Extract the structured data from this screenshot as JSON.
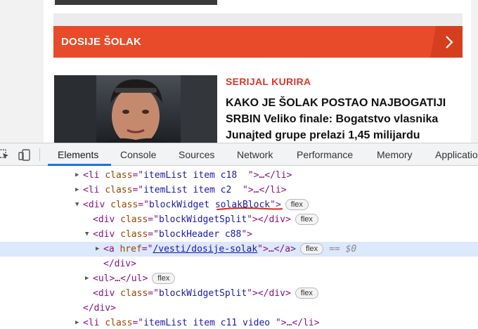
{
  "page": {
    "section_title": "DOSIJE ŠOLAK",
    "section_arrow_icon": "chevron-right-icon",
    "article": {
      "kicker": "SERIJAL KURIRA",
      "headline": "KAKO JE ŠOLAK POSTAO NAJBOGATIJI SRBIN Veliko finale: Bogatstvo vlasnika Junajted grupe prelazi 1,45 milijardu"
    },
    "colors": {
      "section_bar": "#e84b2a",
      "kicker": "#d8372a"
    }
  },
  "devtools": {
    "inspect_icon": "inspect-element-icon",
    "device_icon": "device-toolbar-icon",
    "tabs": [
      {
        "label": "Elements"
      },
      {
        "label": "Console"
      },
      {
        "label": "Sources"
      },
      {
        "label": "Network"
      },
      {
        "label": "Performance"
      },
      {
        "label": "Memory"
      },
      {
        "label": "Applicatio"
      }
    ],
    "dom": {
      "l1": {
        "open": "<li ",
        "attr": "class",
        "eq": "=\"",
        "val": "itemList item c18  ",
        "rest": "\">…</li>"
      },
      "l2": {
        "open": "<li ",
        "attr": "class",
        "eq": "=\"",
        "val": "itemList item c2  ",
        "rest": "\">…</li>"
      },
      "l3": {
        "open": "<div ",
        "attr": "class",
        "eq": "=\"",
        "val1": "blockWidget ",
        "val2": "solakBlock",
        "rest": "\">",
        "badge": "flex"
      },
      "l4": {
        "open": "<div ",
        "attr": "class",
        "eq": "=\"",
        "val": "blockWidgetSplit",
        "rest": "\"></div>",
        "badge": "flex"
      },
      "l5": {
        "open": "<div ",
        "attr": "class",
        "eq": "=\"",
        "val": "blockHeader c88",
        "rest": "\">"
      },
      "l6": {
        "open": "<a ",
        "attr": "href",
        "eq": "=\"",
        "val": "/vesti/dosije-solak",
        "rest": "\">…</a>",
        "badge": "flex",
        "eqvar": "== $0"
      },
      "l7": {
        "text": "</div>"
      },
      "l8": {
        "open": "<ul>…</ul>",
        "badge": "flex"
      },
      "l9": {
        "open": "<div ",
        "attr": "class",
        "eq": "=\"",
        "val": "blockWidgetSplit",
        "rest": "\"></div>",
        "badge": "flex"
      },
      "l10": {
        "text": "</div>"
      },
      "l11": {
        "open": "<li ",
        "attr": "class",
        "eq": "=\"",
        "val": "itemList item c11 video ",
        "rest": "\">…</li>"
      }
    }
  }
}
